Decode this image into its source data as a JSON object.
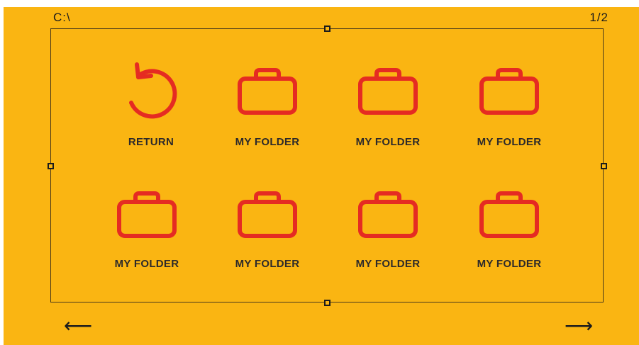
{
  "theme": {
    "background": "#FAB512",
    "icon_color": "#E52B22",
    "text_color": "#2D2A2A",
    "line_color": "#1C1C1C"
  },
  "header": {
    "path": "C:\\",
    "page_indicator": "1/2"
  },
  "return_tile": {
    "label": "RETURN",
    "icon": "return-icon"
  },
  "folders": [
    {
      "label": "MY FOLDER",
      "icon": "folder-icon"
    },
    {
      "label": "MY FOLDER",
      "icon": "folder-icon"
    },
    {
      "label": "MY FOLDER",
      "icon": "folder-icon"
    },
    {
      "label": "MY FOLDER",
      "icon": "folder-icon"
    },
    {
      "label": "MY FOLDER",
      "icon": "folder-icon"
    },
    {
      "label": "MY FOLDER",
      "icon": "folder-icon"
    },
    {
      "label": "MY FOLDER",
      "icon": "folder-icon"
    }
  ],
  "navigation": {
    "prev_symbol": "⟵",
    "next_symbol": "⟶"
  }
}
